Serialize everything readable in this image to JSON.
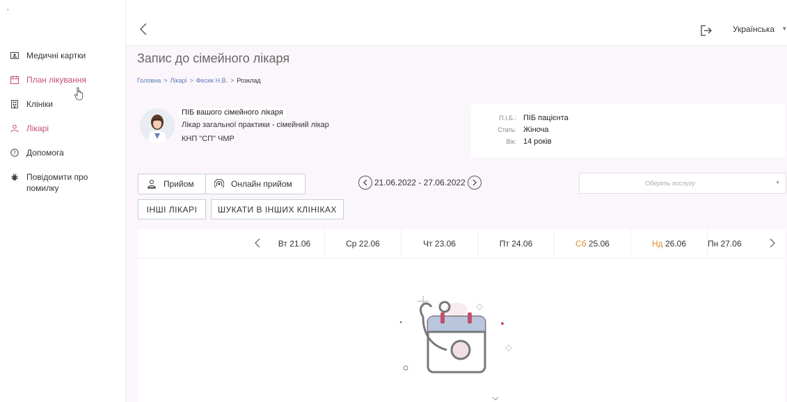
{
  "sidebar": {
    "tick": ",",
    "items": [
      {
        "label": "Медичні картки",
        "icon": "id-card-icon"
      },
      {
        "label": "План лікування",
        "icon": "calendar-icon"
      },
      {
        "label": "Клініки",
        "icon": "building-icon"
      },
      {
        "label": "Лікарі",
        "icon": "doctor-icon"
      },
      {
        "label": "Допомога",
        "icon": "help-icon"
      },
      {
        "label": "Повідомити про помилку",
        "icon": "bug-icon"
      }
    ]
  },
  "topbar": {
    "language": "Українська"
  },
  "page": {
    "title": "Запис до сімейного лікаря",
    "breadcrumb": [
      "Головна",
      "Лікарі",
      "Фесик Н.В.",
      "Розклад"
    ],
    "breadcrumb_sep": ">"
  },
  "doctor": {
    "name": "ПІБ вашого сімейного лікаря",
    "specialty": "Лікар загальної практики - сімейний лікар",
    "organization": "КНП \"СП\" ЧМР"
  },
  "patient": {
    "name_label": "П.І.Б.:",
    "name_value": "ПІБ пацієнта",
    "sex_label": "Стать:",
    "sex_value": "Жіноча",
    "age_label": "Вік:",
    "age_value": "14 років"
  },
  "controls": {
    "receipt": "Прийом",
    "online": "Онлайн прийом",
    "other_doctors": "ІНШІ ЛІКАРІ",
    "search_clinics": "ШУКАТИ В ІНШИХ КЛІНІКАХ",
    "date_range": "21.06.2022 - 27.06.2022",
    "service_placeholder": "Оберіть послугу"
  },
  "days": [
    {
      "pre": "Вт",
      "date": "21.06"
    },
    {
      "pre": "Ср",
      "date": "22.06"
    },
    {
      "pre": "Чт",
      "date": "23.06"
    },
    {
      "pre": "Пт",
      "date": "24.06"
    },
    {
      "pre": "Сб",
      "date": "25.06"
    },
    {
      "pre": "Нд",
      "date": "26.06"
    },
    {
      "pre": "Пн",
      "date": "27.06"
    }
  ],
  "colors": {
    "accent": "#c2506e",
    "weekend": "#e08a3a",
    "link": "#5a7bb5",
    "background": "#fbf6fb"
  }
}
